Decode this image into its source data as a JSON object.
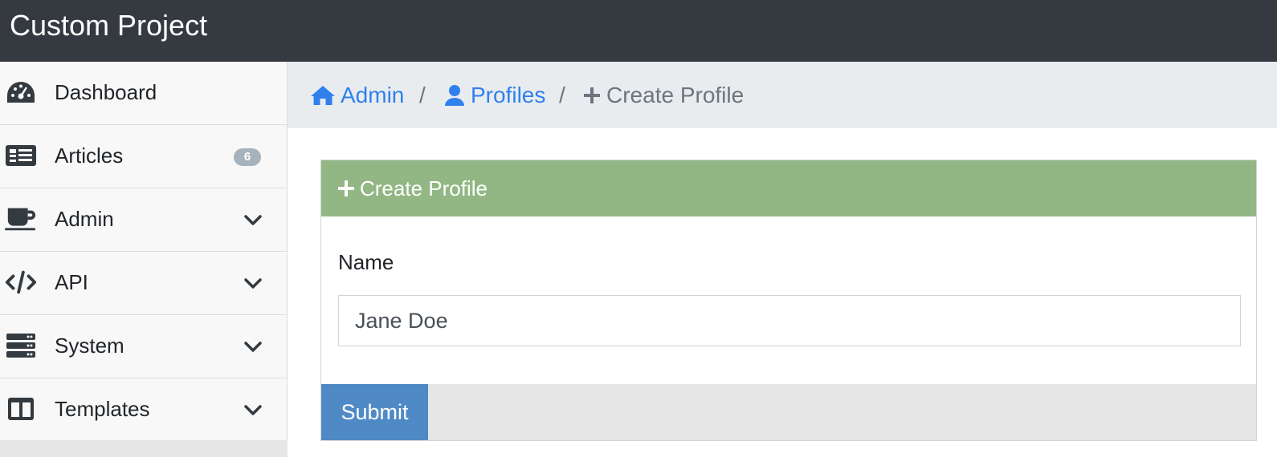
{
  "app": {
    "title": "Custom Project"
  },
  "sidebar": {
    "items": [
      {
        "label": "Dashboard",
        "icon": "tachometer-icon"
      },
      {
        "label": "Articles",
        "icon": "newspaper-icon",
        "badge": "6"
      },
      {
        "label": "Admin",
        "icon": "coffee-icon",
        "expandable": true
      },
      {
        "label": "API",
        "icon": "code-icon",
        "expandable": true
      },
      {
        "label": "System",
        "icon": "server-icon",
        "expandable": true
      },
      {
        "label": "Templates",
        "icon": "columns-icon",
        "expandable": true
      }
    ]
  },
  "breadcrumb": {
    "items": [
      {
        "label": "Admin",
        "icon": "home-icon"
      },
      {
        "label": "Profiles",
        "icon": "user-icon"
      },
      {
        "label": "Create Profile",
        "icon": "plus-icon"
      }
    ],
    "separator": "/"
  },
  "form": {
    "header": "Create Profile",
    "name_label": "Name",
    "name_value": "Jane Doe",
    "submit_label": "Submit"
  },
  "colors": {
    "topbar": "#343a40",
    "card_header": "#93b784",
    "submit": "#4f8ac6",
    "link": "#2f80ed",
    "badge": "#a7b3bc"
  }
}
